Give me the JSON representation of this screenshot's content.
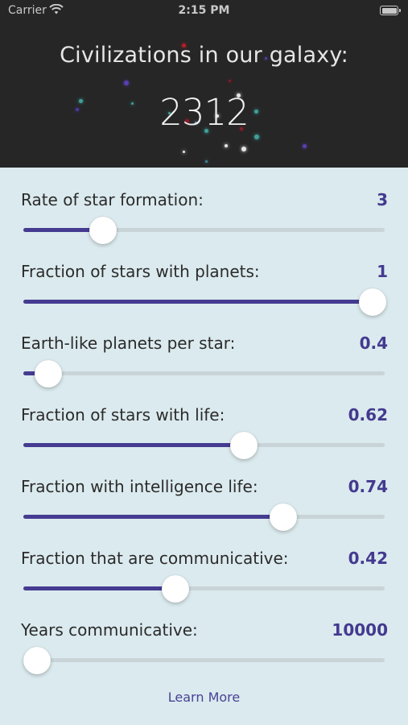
{
  "status_bar": {
    "carrier": "Carrier",
    "time": "2:15 PM"
  },
  "header": {
    "title": "Civilizations in our galaxy:",
    "count": "2312"
  },
  "colors": {
    "accent": "#453b91",
    "value_text": "#433a8f",
    "header_bg": "#262626",
    "body_bg": "#dbeaee"
  },
  "sliders": [
    {
      "label": "Rate of star formation:",
      "value": "3",
      "fraction": 0.22
    },
    {
      "label": "Fraction of stars with planets:",
      "value": "1",
      "fraction": 1.0
    },
    {
      "label": "Earth-like planets per star:",
      "value": "0.4",
      "fraction": 0.07
    },
    {
      "label": "Fraction of stars with life:",
      "value": "0.62",
      "fraction": 0.61
    },
    {
      "label": "Fraction with intelligence life:",
      "value": "0.74",
      "fraction": 0.72
    },
    {
      "label": "Fraction that are communicative:",
      "value": "0.42",
      "fraction": 0.42
    },
    {
      "label": "Years communicative:",
      "value": "10000",
      "fraction": 0.03
    }
  ],
  "footer": {
    "learn_more": "Learn More"
  }
}
